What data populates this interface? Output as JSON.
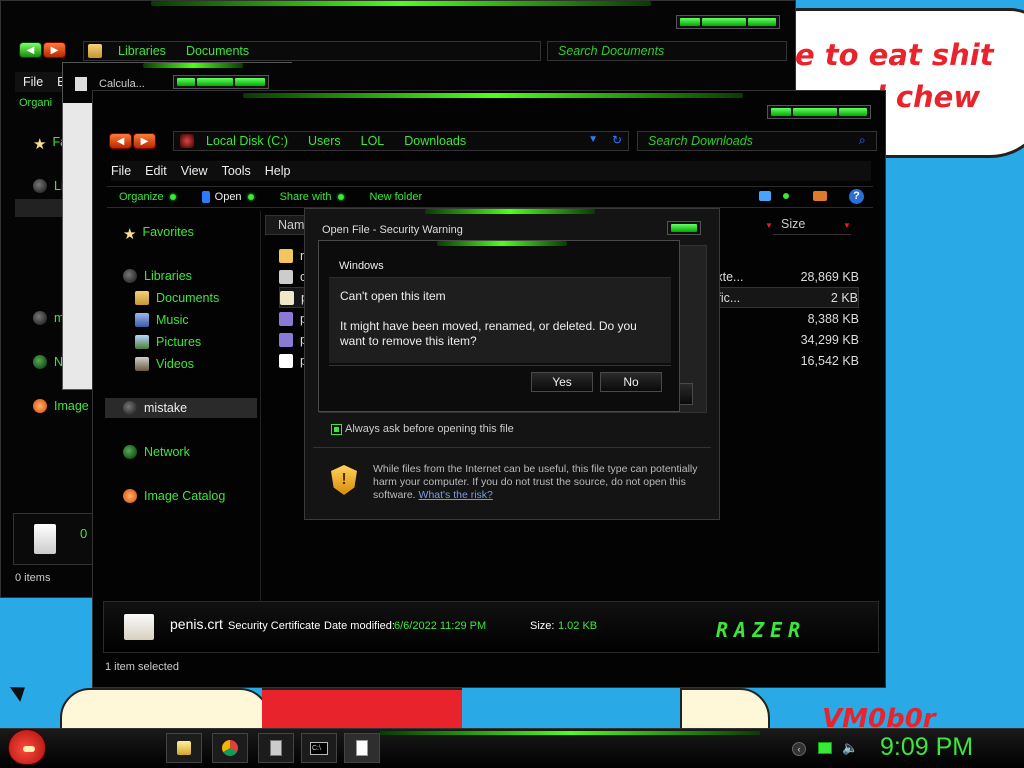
{
  "wallpaper": {
    "bubble_text": "e to eat shit\ne and chew",
    "signature": "VM0b0r"
  },
  "back_window": {
    "breadcrumb": [
      "Libraries",
      "Documents"
    ],
    "search_placeholder": "Search Documents",
    "menu": [
      "File",
      "E"
    ],
    "organize": "Organi",
    "nav_partial": [
      "Fa",
      "Li",
      "m",
      "N",
      "Image"
    ],
    "count": "0",
    "status": "0 items"
  },
  "calc_window": {
    "title": "Calcula..."
  },
  "main_window": {
    "breadcrumb": [
      "Local Disk (C:)",
      "Users",
      "LOL",
      "Downloads"
    ],
    "search_placeholder": "Search Downloads",
    "menu": [
      "File",
      "Edit",
      "View",
      "Tools",
      "Help"
    ],
    "commands": [
      "Organize",
      "Open",
      "Share with",
      "New folder"
    ],
    "nav": {
      "favorites": "Favorites",
      "libraries": "Libraries",
      "documents": "Documents",
      "music": "Music",
      "pictures": "Pictures",
      "videos": "Videos",
      "mistake": "mistake",
      "network": "Network",
      "image_catalog": "Image Catalog"
    },
    "columns": {
      "name": "Nam",
      "size": "Size"
    },
    "files": [
      {
        "name": "n",
        "type": "",
        "size": ""
      },
      {
        "name": "c",
        "type": "n exte...",
        "size": "28,869 KB"
      },
      {
        "name": "p",
        "type": "ertific...",
        "size": "2 KB"
      },
      {
        "name": "p",
        "type": "n",
        "size": "8,388 KB"
      },
      {
        "name": "p",
        "type": "n",
        "size": "34,299 KB"
      },
      {
        "name": "p",
        "type": "n",
        "size": "16,542 KB"
      }
    ],
    "details": {
      "filename": "penis.crt",
      "filetype": "Security Certificate",
      "modified_label": "Date modified:",
      "modified_value": "6/6/2022 11:29 PM",
      "size_label": "Size:",
      "size_value": "1.02 KB",
      "brand": "RAZER"
    },
    "status": "1 item selected"
  },
  "security_dialog": {
    "title": "Open File - Security Warning",
    "checkbox_label": "Always ask before opening this file",
    "checkbox_checked": true,
    "warning_text": "While files from the Internet can be useful, this file type can potentially harm your computer. If you do not trust the source, do not open this software.",
    "risk_link": "What's the risk?"
  },
  "error_dialog": {
    "title": "Windows",
    "heading": "Can't open this item",
    "message": "It might have been moved, renamed, or deleted. Do you want to remove this item?",
    "yes": "Yes",
    "no": "No"
  },
  "taskbar": {
    "clock": "9:09 PM",
    "apps": [
      "explorer-icon",
      "chrome-icon",
      "calculator-icon",
      "cmd-icon",
      "notepad-icon"
    ]
  },
  "colors": {
    "accent": "#3ce63c",
    "desktop": "#29a9e6"
  }
}
